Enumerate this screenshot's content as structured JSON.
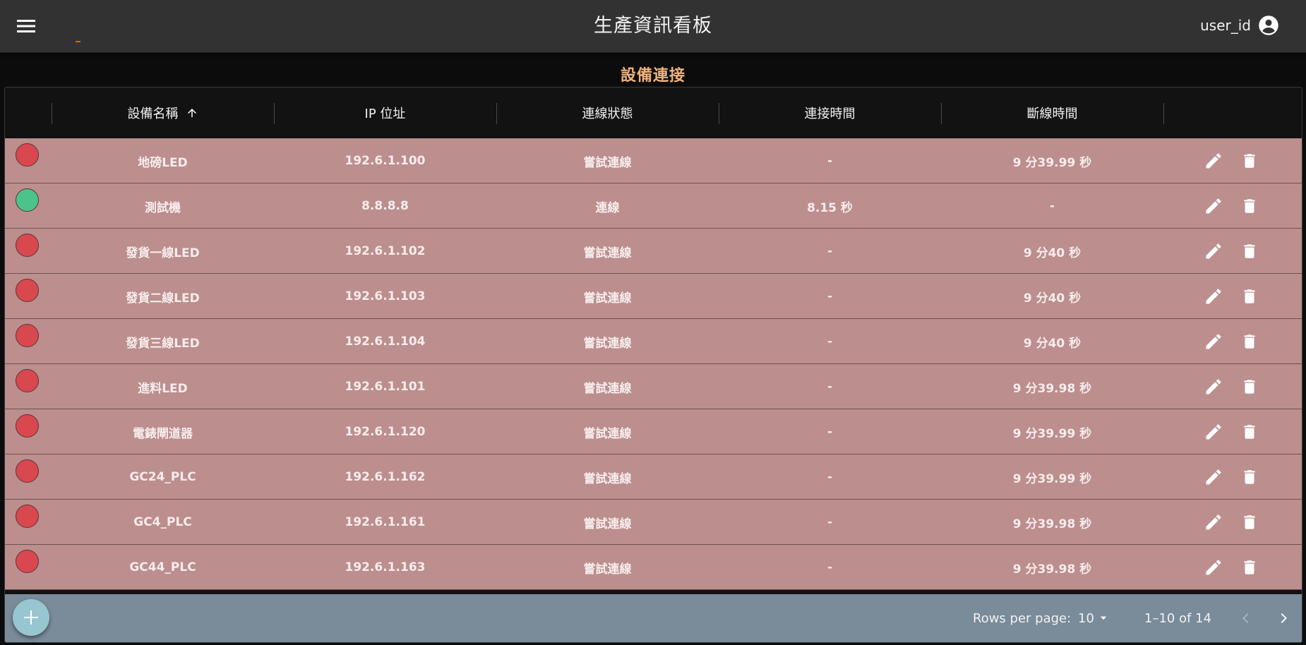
{
  "app": {
    "title": "生產資訊看板",
    "user_id": "user_id"
  },
  "section": {
    "title": "設備連接"
  },
  "table": {
    "columns": [
      "設備名稱",
      "IP 位址",
      "連線狀態",
      "連接時間",
      "斷線時間"
    ],
    "rows": [
      {
        "status": "red",
        "name": "地磅LED",
        "ip": "192.6.1.100",
        "state": "嘗試連線",
        "connect": "-",
        "disconnect": "9 分39.99 秒"
      },
      {
        "status": "green",
        "name": "測試機",
        "ip": "8.8.8.8",
        "state": "連線",
        "connect": "8.15 秒",
        "disconnect": "-"
      },
      {
        "status": "red",
        "name": "發貨一線LED",
        "ip": "192.6.1.102",
        "state": "嘗試連線",
        "connect": "-",
        "disconnect": "9 分40 秒"
      },
      {
        "status": "red",
        "name": "發貨二線LED",
        "ip": "192.6.1.103",
        "state": "嘗試連線",
        "connect": "-",
        "disconnect": "9 分40 秒"
      },
      {
        "status": "red",
        "name": "發貨三線LED",
        "ip": "192.6.1.104",
        "state": "嘗試連線",
        "connect": "-",
        "disconnect": "9 分40 秒"
      },
      {
        "status": "red",
        "name": "進料LED",
        "ip": "192.6.1.101",
        "state": "嘗試連線",
        "connect": "-",
        "disconnect": "9 分39.98 秒"
      },
      {
        "status": "red",
        "name": "電錶閘道器",
        "ip": "192.6.1.120",
        "state": "嘗試連線",
        "connect": "-",
        "disconnect": "9 分39.99 秒"
      },
      {
        "status": "red",
        "name": "GC24_PLC",
        "ip": "192.6.1.162",
        "state": "嘗試連線",
        "connect": "-",
        "disconnect": "9 分39.99 秒"
      },
      {
        "status": "red",
        "name": "GC4_PLC",
        "ip": "192.6.1.161",
        "state": "嘗試連線",
        "connect": "-",
        "disconnect": "9 分39.98 秒"
      },
      {
        "status": "red",
        "name": "GC44_PLC",
        "ip": "192.6.1.163",
        "state": "嘗試連線",
        "connect": "-",
        "disconnect": "9 分39.98 秒"
      }
    ]
  },
  "pagination": {
    "rows_per_page_label": "Rows per page:",
    "rows_per_page": "10",
    "range": "1–10 of 14"
  },
  "colors": {
    "status_red": "#d9484f",
    "status_green": "#4cc38a",
    "row_bg": "#bc8e8e",
    "accent_title": "#f0b27a"
  }
}
